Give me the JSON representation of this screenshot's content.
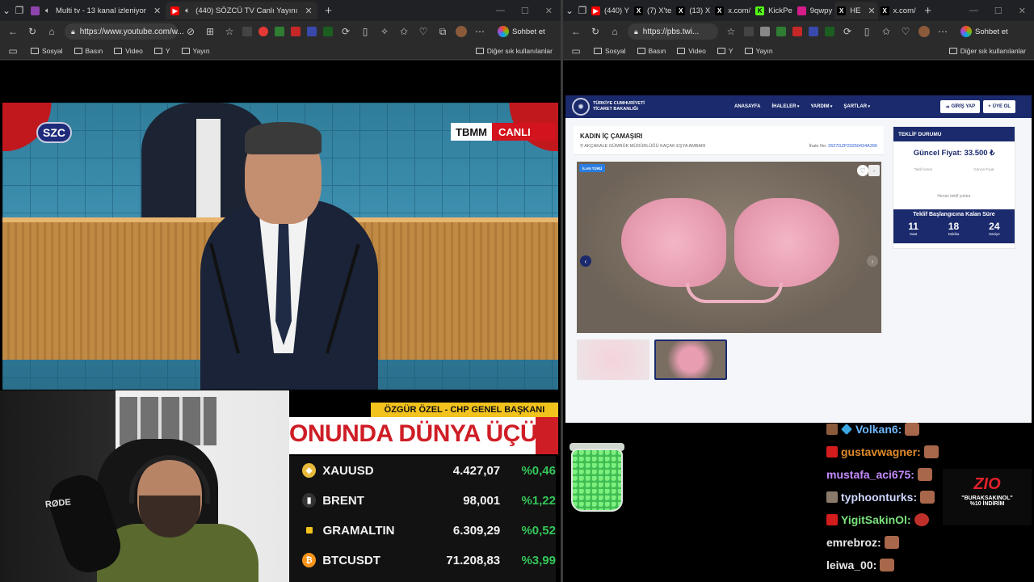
{
  "left_window": {
    "tabs": [
      {
        "title": "Multi tv - 13 kanal izleniyor",
        "favicon": "purple",
        "audio": true
      },
      {
        "title": "(440) SÖZCÜ TV Canlı Yayını",
        "favicon": "youtube",
        "audio": true
      }
    ],
    "url": "https://www.youtube.com/w...",
    "copilot_label": "Sohbet et",
    "bookmarks": [
      "Sosyal",
      "Basın",
      "Video",
      "Y",
      "Yayın"
    ],
    "bookmarks_other": "Diğer sık kullanılanlar"
  },
  "broadcast": {
    "channel_logo": "SZC",
    "source_tag": "TBMM",
    "live_tag": "CANLI",
    "speaker_caption": "ÖZGÜR ÖZEL - CHP GENEL BAŞKANI",
    "headline": "ONUNDA DÜNYA ÜÇÜNCÜSÜ",
    "markets": [
      {
        "symbol": "XAUUSD",
        "value": "4.427,07",
        "change": "%0,46",
        "icon_color": "#e7b93a"
      },
      {
        "symbol": "BRENT",
        "value": "98,001",
        "change": "%1,22",
        "icon_color": "#333333"
      },
      {
        "symbol": "GRAMALTIN",
        "value": "6.309,29",
        "change": "%0,52",
        "icon_color": "#f2c21d"
      },
      {
        "symbol": "BTCUSDT",
        "value": "71.208,83",
        "change": "%3,99",
        "icon_color": "#f7931a"
      }
    ]
  },
  "webcam": {
    "mic_brand": "RØDE"
  },
  "right_window": {
    "tabs": [
      {
        "title": "(440) Y",
        "favicon": "youtube"
      },
      {
        "title": "(7) X'te",
        "favicon": "x"
      },
      {
        "title": "(13) X",
        "favicon": "x"
      },
      {
        "title": "x.com/",
        "favicon": "x"
      },
      {
        "title": "KickPe",
        "favicon": "kick"
      },
      {
        "title": "9qwpy",
        "favicon": "pink"
      },
      {
        "title": "HE",
        "favicon": "x"
      },
      {
        "title": "x.com/",
        "favicon": "x"
      }
    ],
    "url": "https://pbs.twi...",
    "copilot_label": "Sohbet et",
    "bookmarks": [
      "Sosyal",
      "Basın",
      "Video",
      "Y",
      "Yayın"
    ],
    "bookmarks_other": "Diğer sık kullanılanlar"
  },
  "auction_site": {
    "logo_text": "TÜRKİYE CUMHURİYETİ TİCARET BAKANLIĞI",
    "nav": [
      "ANASAYFA",
      "İHALELER",
      "YARDIM",
      "ŞARTLAR"
    ],
    "login_label": "GİRİŞ YAP",
    "signup_label": "ÜYE OL",
    "product_title": "KADIN İÇ ÇAMAŞIRI",
    "location": "AKÇAKALE GÜMRÜK MÜDÜRLÜĞÜ KAÇAK EŞYA AMBARI",
    "tender_label": "İhale No:",
    "tender_no": "2627GZP20250434A396",
    "badge": "İLAN TÜRÜ",
    "bid_status_title": "TEKLİF DURUMU",
    "current_price": "Güncel Fiyat: 33.500 ₺",
    "col_a": "Teklif veren",
    "col_b": "Güncel Fiyat",
    "no_bids": "Henüz teklif yoktur",
    "countdown_title": "Teklif Başlangıcına Kalan Süre",
    "countdown": [
      {
        "value": "11",
        "unit": "Saat"
      },
      {
        "value": "18",
        "unit": "Dakika"
      },
      {
        "value": "24",
        "unit": "Saniye"
      }
    ]
  },
  "chat": [
    {
      "user": "Volkan6:",
      "color": "#6fb7ff"
    },
    {
      "user": "gustavwagner:",
      "color": "#e08a2a"
    },
    {
      "user": "mustafa_aci675:",
      "color": "#c58bff"
    },
    {
      "user": "typhoonturks:",
      "color": "#cfd8ff"
    },
    {
      "user": "YigitSakinOl:",
      "color": "#7be37b"
    },
    {
      "user": "emrebroz:",
      "color": "#e8e8e8"
    },
    {
      "user": "leiwa_00:",
      "color": "#e8e8e8"
    }
  ],
  "promo": {
    "logo": "ZIO",
    "line1": "\"BURAKSAKINOL\"",
    "line2": "%10 İNDİRİM"
  },
  "window_controls": {
    "min": "—",
    "max": "☐",
    "close": "✕"
  }
}
